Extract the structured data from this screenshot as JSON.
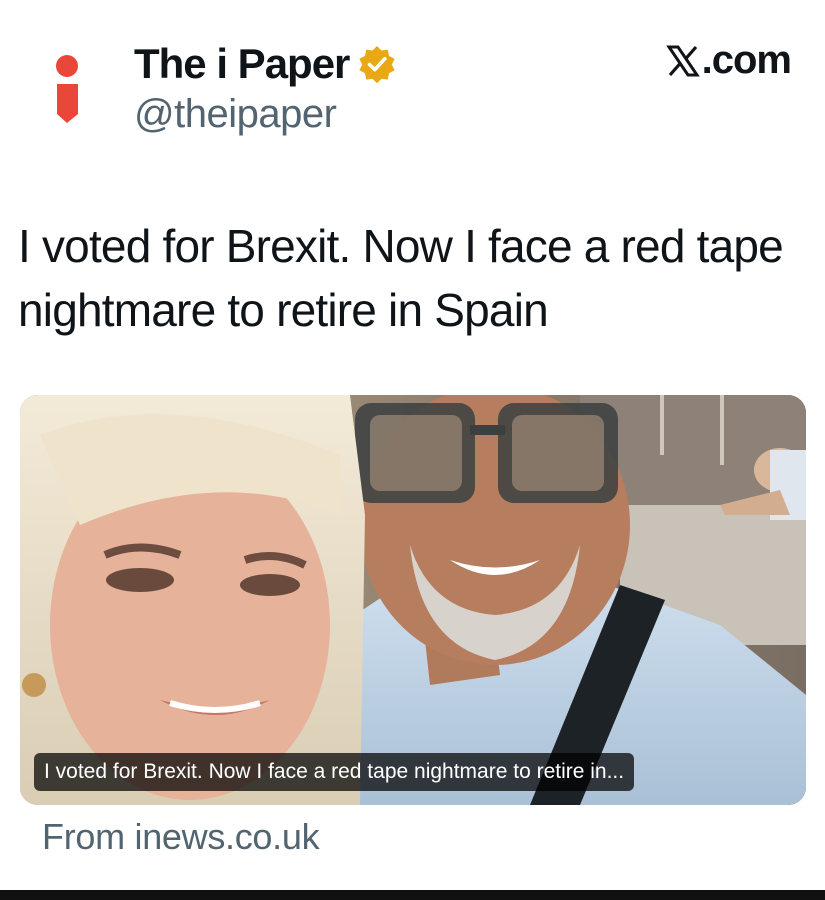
{
  "account": {
    "display_name": "The i Paper",
    "handle": "@theipaper",
    "avatar_icon": "i-paper-logo-icon",
    "verified_icon": "verified-badge-icon",
    "brand_color": "#e8473a",
    "verified_color": "#e8a915"
  },
  "platform": {
    "label": ".com",
    "logo_icon": "x-logo-icon"
  },
  "tweet": {
    "text": "I voted for Brexit. Now I face a red tape nightmare to retire in Spain"
  },
  "link_card": {
    "caption": "I voted for Brexit. Now I face a red tape nightmare to retire in...",
    "source": "From inews.co.uk"
  }
}
